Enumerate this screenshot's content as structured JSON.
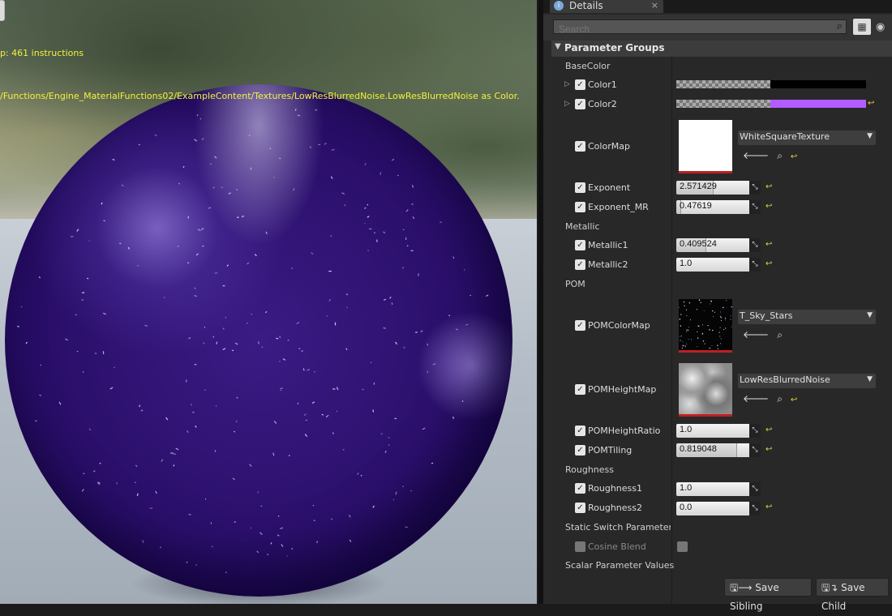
{
  "viewport": {
    "stats_text": "p: 461 instructions",
    "path_text": "/Functions/Engine_MaterialFunctions02/ExampleContent/Textures/LowResBlurredNoise.LowResBlurredNoise as Color."
  },
  "tab": {
    "title": "Details",
    "icon": "info-icon",
    "close": "×"
  },
  "search": {
    "placeholder": "Search"
  },
  "groups_header": "Parameter Groups",
  "sections": {
    "basecolor": "BaseColor",
    "metallic": "Metallic",
    "pom": "POM",
    "roughness": "Roughness",
    "static_switch": "Static Switch Parameter V",
    "scalar": "Scalar Parameter Values"
  },
  "params": {
    "color1": {
      "label": "Color1",
      "color": "#000000"
    },
    "color2": {
      "label": "Color2",
      "color": "#b35cff"
    },
    "colormap": {
      "label": "ColorMap",
      "texture": "WhiteSquareTexture"
    },
    "exponent": {
      "label": "Exponent",
      "value": "2.571429",
      "fill": 0.5
    },
    "exponent_mr": {
      "label": "Exponent_MR",
      "value": "0.47619",
      "fill": 0.05
    },
    "metallic1": {
      "label": "Metallic1",
      "value": "0.409524",
      "fill": 0.4
    },
    "metallic2": {
      "label": "Metallic2",
      "value": "1.0",
      "fill": 0
    },
    "pomcolormap": {
      "label": "POMColorMap",
      "texture": "T_Sky_Stars"
    },
    "pomheightmap": {
      "label": "POMHeightMap",
      "texture": "LowResBlurredNoise"
    },
    "pomheightratio": {
      "label": "POMHeightRatio",
      "value": "1.0",
      "fill": 0
    },
    "pomtiling": {
      "label": "POMTiling",
      "value": "0.819048",
      "fill": 0.82
    },
    "roughness1": {
      "label": "Roughness1",
      "value": "1.0",
      "fill": 0
    },
    "roughness2": {
      "label": "Roughness2",
      "value": "0.0",
      "fill": 0
    },
    "cosine_blend": {
      "label": "Cosine Blend"
    }
  },
  "footer": {
    "save_sibling": "Save Sibling",
    "save_child": "Save Child"
  }
}
